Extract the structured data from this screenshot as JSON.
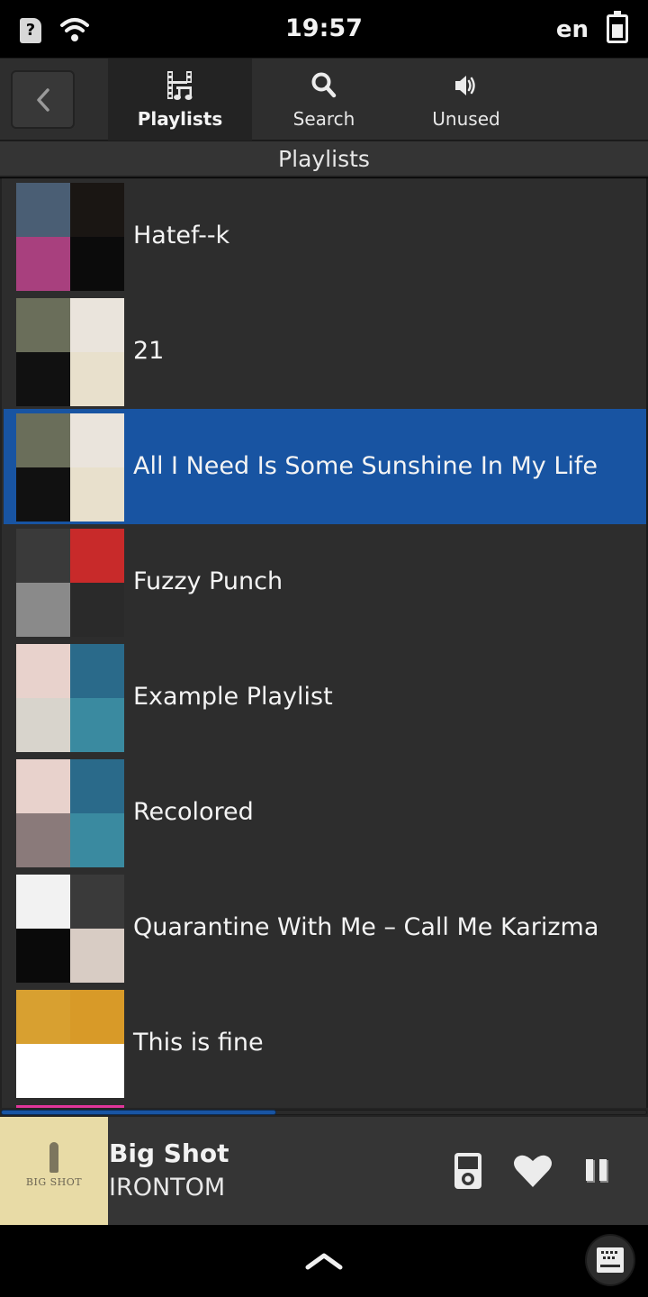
{
  "status_bar": {
    "sim_label": "?",
    "time": "19:57",
    "language": "en",
    "icons": [
      "sim-unknown-icon",
      "wifi-icon",
      "battery-icon"
    ]
  },
  "header": {
    "back_icon": "chevron-left-icon",
    "tabs": [
      {
        "label": "Playlists",
        "icon": "playlist-film-music-icon",
        "active": true
      },
      {
        "label": "Search",
        "icon": "search-icon",
        "active": false
      },
      {
        "label": "Unused",
        "icon": "speaker-icon",
        "active": false
      }
    ]
  },
  "section_title": "Playlists",
  "playlists": [
    {
      "name": "Hatef--k",
      "selected": false,
      "art_colors": [
        "#4a5e74",
        "#1a1613",
        "#a8407e",
        "#0b0b0b"
      ]
    },
    {
      "name": "21",
      "selected": false,
      "art_colors": [
        "#6a6e5a",
        "#eae4dc",
        "#111111",
        "#e8e0cc"
      ]
    },
    {
      "name": "All I Need Is Some Sunshine In My Life",
      "selected": true,
      "art_colors": [
        "#6a6e5a",
        "#eae4dc",
        "#111111",
        "#e8e0cc"
      ]
    },
    {
      "name": "Fuzzy Punch",
      "selected": false,
      "art_colors": [
        "#3a3a3a",
        "#c82a2a",
        "#8a8a8a",
        "#2a2a2a"
      ]
    },
    {
      "name": "Example Playlist",
      "selected": false,
      "art_colors": [
        "#e8d2cc",
        "#2a6a8a",
        "#d8d4cc",
        "#3a8aa0"
      ]
    },
    {
      "name": "Recolored",
      "selected": false,
      "art_colors": [
        "#e8d2cc",
        "#2a6a8a",
        "#8a7a7a",
        "#3a8aa0"
      ]
    },
    {
      "name": "Quarantine With Me – Call Me Karizma",
      "selected": false,
      "art_colors": [
        "#f2f2f2",
        "#3a3a3a",
        "#0a0a0a",
        "#d8ccc4"
      ]
    },
    {
      "name": "This is fine",
      "selected": false,
      "art_colors": [
        "#d8a030",
        "#d89a28",
        "#ffffff",
        "#ffffff"
      ]
    },
    {
      "name": "",
      "selected": false,
      "art_colors": [
        "#e0359a",
        "#e0359a",
        "#e0359a",
        "#e0359a"
      ]
    }
  ],
  "playback": {
    "progress_percent": 42.6,
    "title": "Big Shot",
    "artist": "IRONTOM",
    "cover_text": "BIG SHOT",
    "buttons": [
      {
        "name": "device-output",
        "icon": "media-player-icon"
      },
      {
        "name": "favorite",
        "icon": "heart-icon"
      },
      {
        "name": "pause",
        "icon": "pause-icon"
      }
    ]
  },
  "bottom_bar": {
    "home_icon": "chevron-up-icon",
    "keyboard_icon": "keyboard-icon"
  },
  "colors": {
    "accent": "#1854a2",
    "background": "#2d2d2d",
    "header": "#2e2e2e",
    "now_playing_bg": "#353535",
    "favorite_pink": "#e0359a"
  }
}
